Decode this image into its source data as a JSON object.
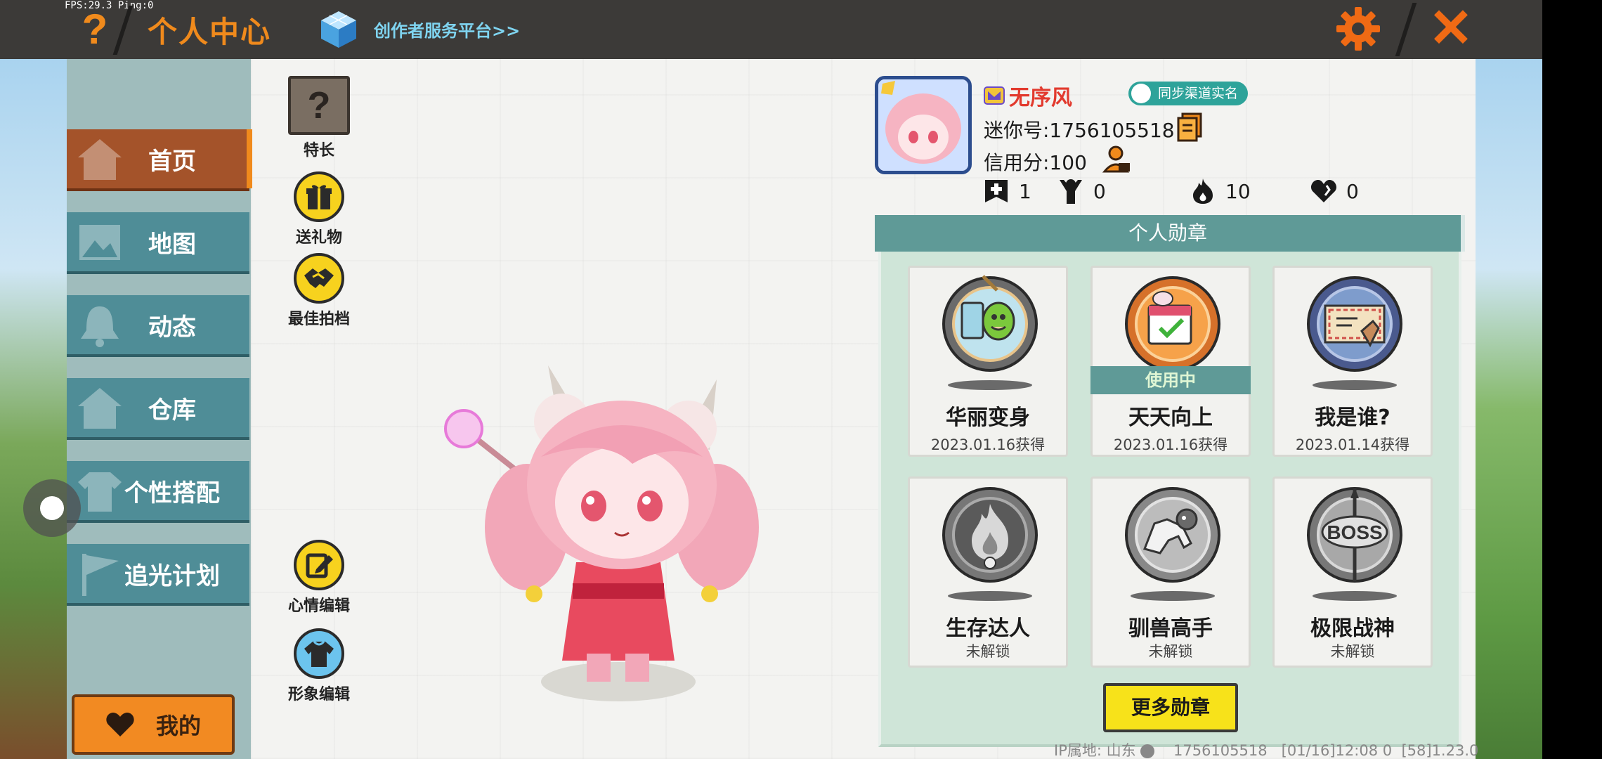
{
  "status": {
    "fps": "FPS:29.3",
    "ping": "Ping:0"
  },
  "topbar": {
    "help_label": "?",
    "title": "个人中心",
    "creator_link": "创作者服务平台>>",
    "close_label": "✕"
  },
  "sidebar": {
    "items": [
      {
        "label": "首页",
        "icon": "house-icon",
        "active": true
      },
      {
        "label": "地图",
        "icon": "picture-icon"
      },
      {
        "label": "动态",
        "icon": "bell-icon"
      },
      {
        "label": "仓库",
        "icon": "house-icon"
      },
      {
        "label": "个性搭配",
        "icon": "shirt-icon"
      },
      {
        "label": "追光计划",
        "icon": "flag-icon"
      }
    ],
    "mine_label": "我的"
  },
  "actions": {
    "talent": {
      "label": "特长",
      "glyph": "?"
    },
    "gift": {
      "label": "送礼物"
    },
    "partner": {
      "label": "最佳拍档"
    },
    "mood": {
      "label": "心情编辑"
    },
    "look": {
      "label": "形象编辑"
    }
  },
  "profile": {
    "username": "无序风",
    "realname_tag": "同步渠道实名",
    "mini_id": "迷你号:1756105518",
    "credit": "信用分:100",
    "stats": {
      "add": "1",
      "fans": "0",
      "fire": "10",
      "likes": "0"
    }
  },
  "badges": {
    "header": "个人勋章",
    "items": [
      {
        "name": "华丽变身",
        "date": "2023.01.16获得",
        "unlocked": true
      },
      {
        "name": "天天向上",
        "date": "2023.01.16获得",
        "unlocked": true,
        "in_use": "使用中"
      },
      {
        "name": "我是谁?",
        "date": "2023.01.14获得",
        "unlocked": true
      },
      {
        "name": "生存达人",
        "date": "未解锁",
        "unlocked": false
      },
      {
        "name": "驯兽高手",
        "date": "未解锁",
        "unlocked": false
      },
      {
        "name": "极限战神",
        "date": "未解锁",
        "unlocked": false
      }
    ],
    "more_label": "更多勋章"
  },
  "footer": {
    "ip": "IP属地: 山东",
    "uid": "1756105518",
    "time": "[01/16]12:08 0",
    "version": "[58]1.23.0"
  },
  "colors": {
    "accent_orange": "#f08a1c",
    "teal": "#4f8d97",
    "active_brown": "#a4532a",
    "username_red": "#e23a2e",
    "badge_header": "#5f9a97",
    "more_button": "#f7e21a"
  }
}
